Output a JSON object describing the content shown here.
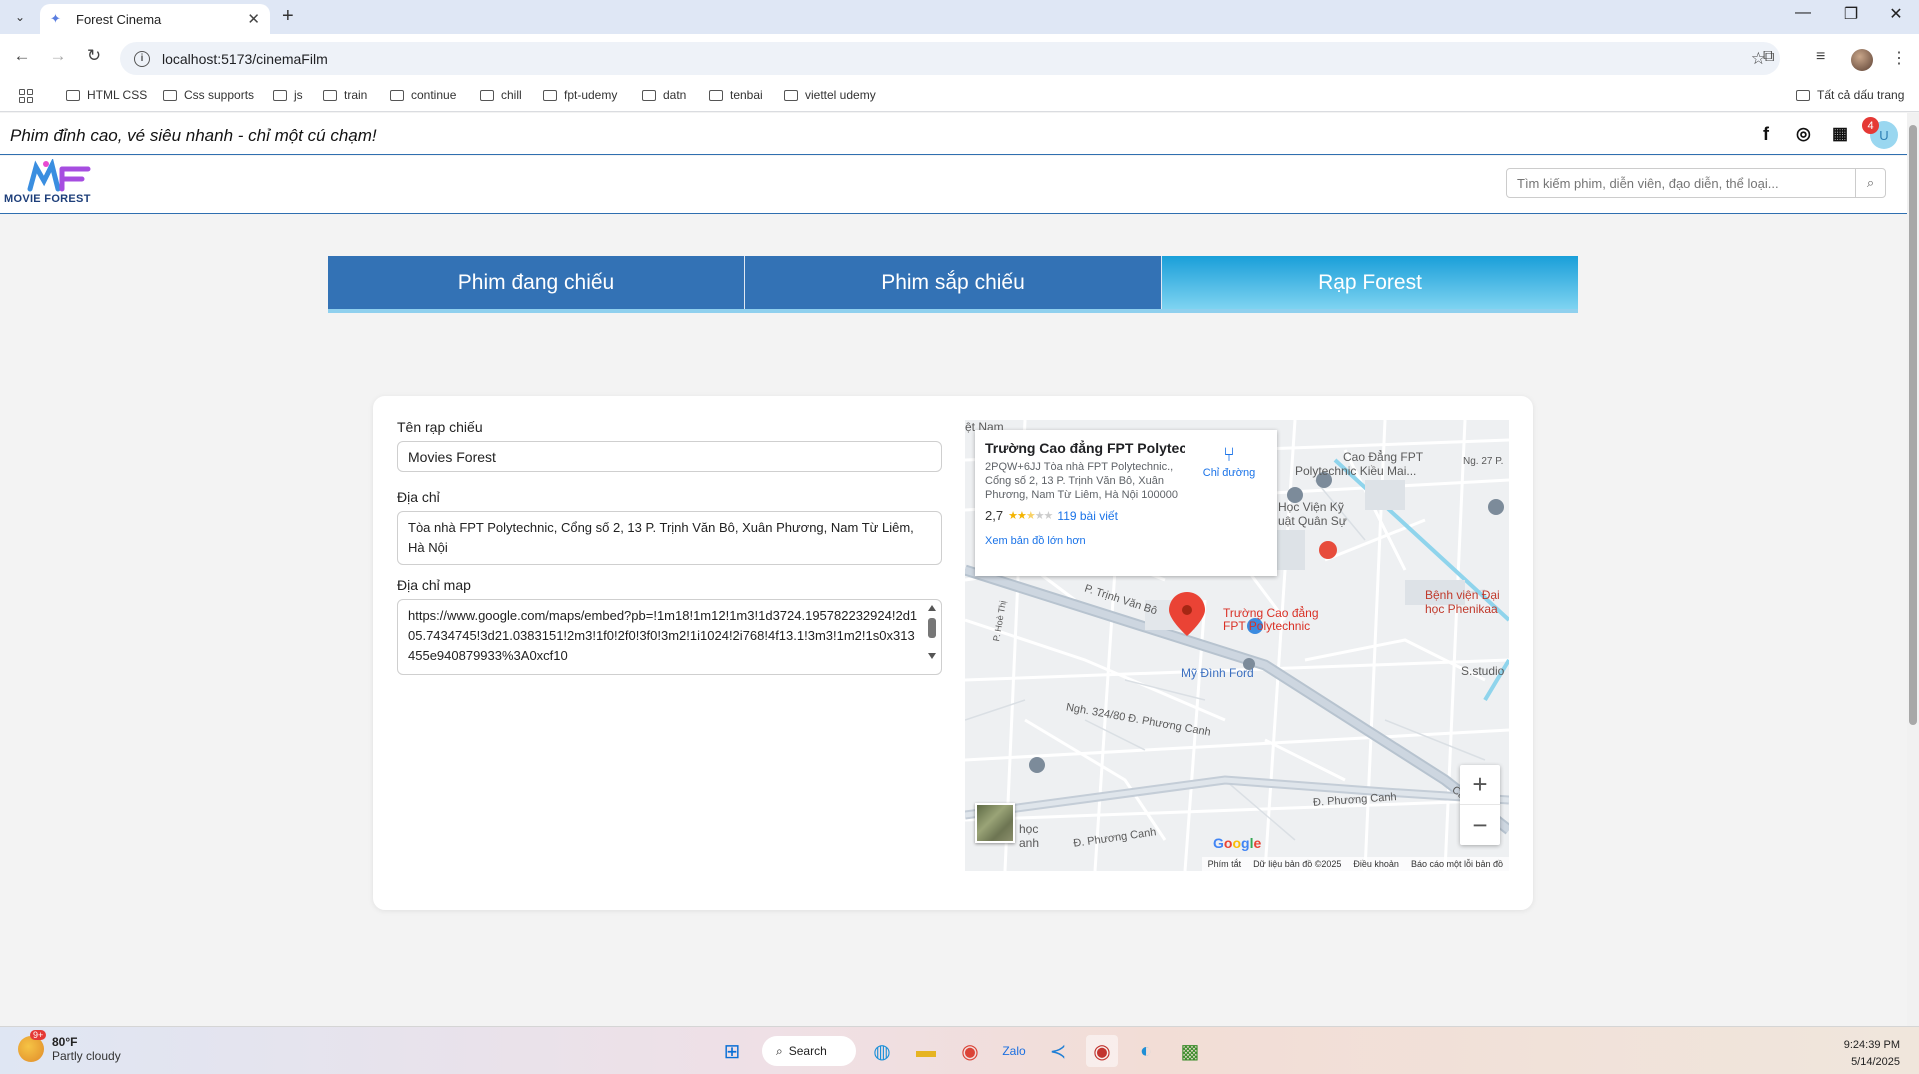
{
  "browser": {
    "tab_title": "Forest Cinema",
    "url": "localhost:5173/cinemaFilm",
    "bookmarks": [
      "HTML CSS",
      "Css supports",
      "js",
      "train",
      "continue",
      "chill",
      "fpt-udemy",
      "datn",
      "tenbai",
      "viettel udemy"
    ],
    "all_bookmarks": "Tất cả dấu trang"
  },
  "site": {
    "slogan": "Phim đỉnh cao, vé siêu nhanh - chỉ một cú chạm!",
    "notification_count": "4",
    "user_initial": "U",
    "logo_text": "MOVIE FOREST",
    "search_placeholder": "Tìm kiếm phim, diễn viên, đạo diễn, thể loại...",
    "nav_tabs": [
      {
        "label": "Phim đang chiếu",
        "active": false
      },
      {
        "label": "Phim sắp chiếu",
        "active": false
      },
      {
        "label": "Rạp Forest",
        "active": true
      }
    ]
  },
  "form": {
    "name_label": "Tên rạp chiếu",
    "name_value": "Movies Forest",
    "address_label": "Địa chỉ",
    "address_value": "Tòa nhà FPT Polytechnic, Cổng số 2, 13 P. Trịnh Văn Bô, Xuân Phương, Nam Từ Liêm, Hà Nội",
    "map_label": "Địa chỉ map",
    "map_value": "https://www.google.com/maps/embed?pb=!1m18!1m12!1m3!1d3724.195782232924!2d105.7434745!3d21.0383151!2m3!1f0!2f0!3f0!3m2!1i1024!2i768!4f13.1!3m3!1m2!1s0x313455e940879933%3A0xcf10"
  },
  "map": {
    "place_title": "Trường Cao đẳng FPT Polytec...",
    "place_address": "2PQW+6JJ Tòa nhà FPT Polytechnic., Cổng số 2, 13 P. Trịnh Văn Bô, Xuân Phương, Nam Từ Liêm, Hà Nội 100000",
    "rating": "2,7",
    "rating_stars": 2.7,
    "reviews": "119 bài viết",
    "view_larger": "Xem bản đồ lớn hơn",
    "directions": "Chỉ đường",
    "marker_label_1": "Trường Cao đẳng",
    "marker_label_2": "FPT Polytechnic",
    "labels": {
      "l1": "ệt Nam",
      "l2": "Cao Đẳng FPT",
      "l3": "Polytechnic Kiều Mai...",
      "l4": "Ng. 27 P.",
      "l5": "Học Viện Kỹ",
      "l6": "uật Quân Sự",
      "l7": "Bệnh viện Đại",
      "l8": "học Phenikaa",
      "l9": "P. Trịnh Văn Bô",
      "l10": "Mỹ Đình Ford",
      "l11": "S.studio",
      "l12": "P. Hoè Thị",
      "l13": "Ngh. 324/80 Đ. Phương Canh",
      "l14": "Đ. Phương Canh",
      "l15": "Đ. Phương Canh",
      "l16": "Cầu Vo",
      "l17": "học",
      "l18": "anh"
    },
    "footer": [
      "Phím tắt",
      "Dữ liệu bản đồ ©2025",
      "Điều khoản",
      "Báo cáo một lỗi bản đồ"
    ],
    "google": "Google"
  },
  "taskbar": {
    "weather_temp": "80°F",
    "weather_desc": "Partly cloudy",
    "weather_badge": "9+",
    "search_label": "Search",
    "time": "9:24:39 PM",
    "date": "5/14/2025"
  }
}
